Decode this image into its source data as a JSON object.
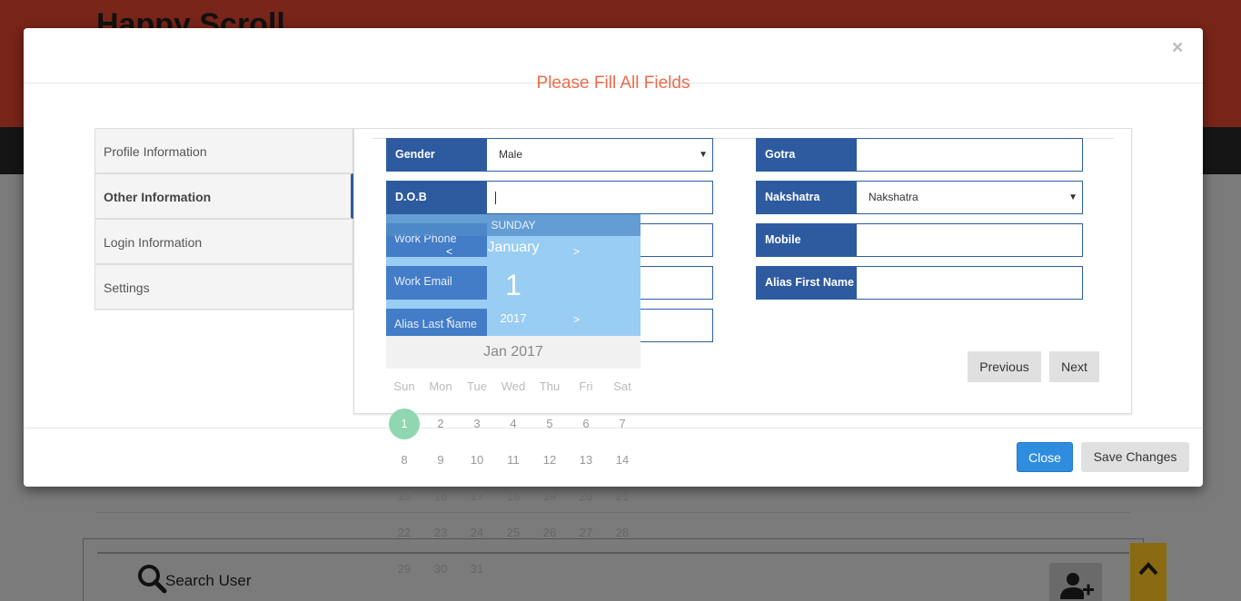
{
  "background": {
    "brand": "Happy Scroll",
    "search_placeholder": "Search User"
  },
  "modal": {
    "title": "Please Fill All Fields",
    "close_x": "×",
    "tabs": [
      {
        "label": "Profile Information",
        "active": false
      },
      {
        "label": "Other Information",
        "active": true
      },
      {
        "label": "Login Information",
        "active": false
      },
      {
        "label": "Settings",
        "active": false
      }
    ],
    "fields": {
      "gender": {
        "label": "Gender",
        "value": "Male"
      },
      "dob": {
        "label": "D.O.B",
        "value": ""
      },
      "work_phone": {
        "label": "Work Phone",
        "value": ""
      },
      "work_email": {
        "label": "Work Email",
        "value": ""
      },
      "alias_last_name": {
        "label": "Alias Last Name",
        "value": ""
      },
      "gotra": {
        "label": "Gotra",
        "value": ""
      },
      "nakshatra": {
        "label": "Nakshatra",
        "value": "Nakshatra"
      },
      "mobile": {
        "label": "Mobile",
        "value": ""
      },
      "alias_first_name": {
        "label": "Alias First Name",
        "value": ""
      }
    },
    "buttons": {
      "previous": "Previous",
      "next": "Next",
      "close": "Close",
      "save": "Save Changes"
    }
  },
  "datepicker": {
    "day_name": "SUNDAY",
    "month": "January",
    "day": "1",
    "year": "2017",
    "prev_symbol": "<",
    "next_symbol": ">",
    "calendar_title": "Jan 2017",
    "weekdays": [
      "Sun",
      "Mon",
      "Tue",
      "Wed",
      "Thu",
      "Fri",
      "Sat"
    ],
    "weeks": [
      [
        "1",
        "2",
        "3",
        "4",
        "5",
        "6",
        "7"
      ],
      [
        "8",
        "9",
        "10",
        "11",
        "12",
        "13",
        "14"
      ],
      [
        "15",
        "16",
        "17",
        "18",
        "19",
        "20",
        "21"
      ],
      [
        "22",
        "23",
        "24",
        "25",
        "26",
        "27",
        "28"
      ],
      [
        "29",
        "30",
        "31"
      ]
    ],
    "selected_day": "1",
    "selected_color": "#8fd7b0"
  },
  "colors": {
    "label_bg": "#2e5aa0",
    "title": "#ee6a4a",
    "close_button": "#2f8de0"
  }
}
